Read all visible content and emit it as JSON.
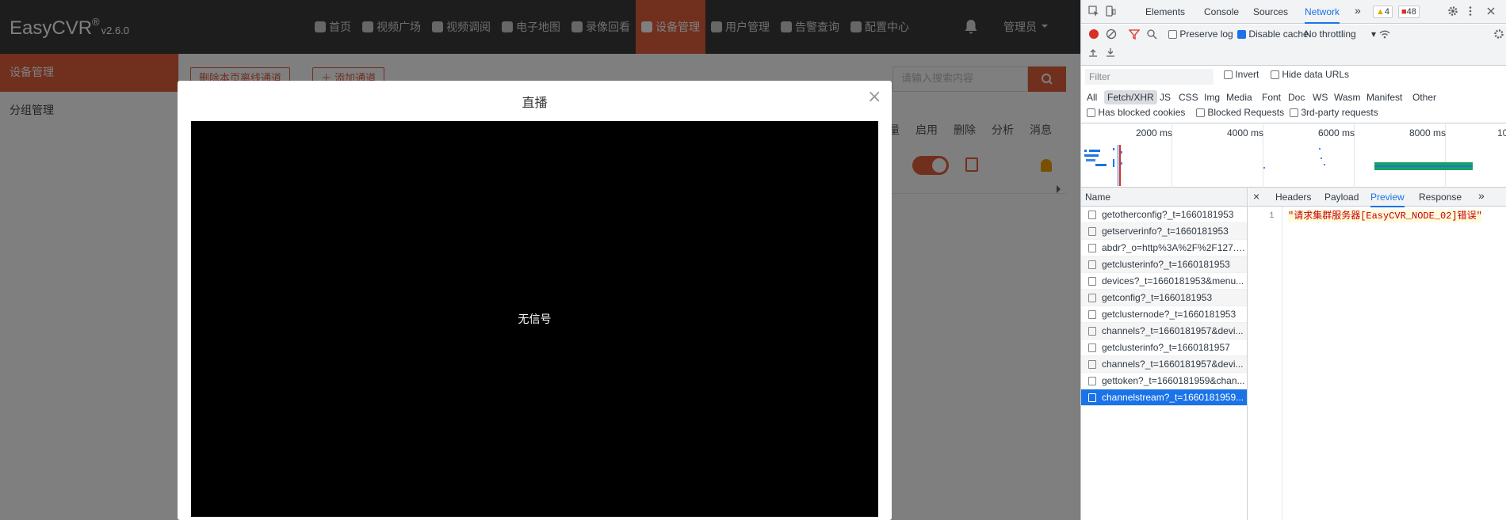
{
  "app": {
    "brand": "EasyCVR",
    "brand_mark": "®",
    "version": "v2.6.0",
    "nav": [
      {
        "label": "首页",
        "icon": "dashboard-icon"
      },
      {
        "label": "视频广场",
        "icon": "play-circle-icon"
      },
      {
        "label": "视频调阅",
        "icon": "grid-icon"
      },
      {
        "label": "电子地图",
        "icon": "map-pin-icon"
      },
      {
        "label": "录像回看",
        "icon": "video-camera-icon"
      },
      {
        "label": "设备管理",
        "icon": "device-icon",
        "active": true
      },
      {
        "label": "用户管理",
        "icon": "user-icon"
      },
      {
        "label": "告警查询",
        "icon": "alarm-icon"
      },
      {
        "label": "配置中心",
        "icon": "gear-icon"
      }
    ],
    "user": "管理员",
    "accent": "#e25e3d",
    "sidebar": [
      {
        "label": "设备管理",
        "active": true
      },
      {
        "label": "分组管理"
      }
    ],
    "toolbar": {
      "delete_offline": "删除本页离线通道",
      "add_channel": "添加通道",
      "search_placeholder": "请输入搜索内容"
    },
    "columns": [
      "量",
      "启用",
      "删除",
      "分析",
      "消息"
    ]
  },
  "dialog": {
    "title": "直播",
    "close": "×",
    "no_signal": "无信号"
  },
  "devtools": {
    "tabs": [
      "Elements",
      "Console",
      "Sources",
      "Network"
    ],
    "active_tab": "Network",
    "more": "»",
    "warnings": "4",
    "errors": "48",
    "preserve_log": "Preserve log",
    "disable_cache": "Disable cache",
    "throttling": "No throttling",
    "filter_placeholder": "Filter",
    "invert": "Invert",
    "hide_data_urls": "Hide data URLs",
    "types": [
      "All",
      "Fetch/XHR",
      "JS",
      "CSS",
      "Img",
      "Media",
      "Font",
      "Doc",
      "WS",
      "Wasm",
      "Manifest",
      "Other"
    ],
    "active_type": "Fetch/XHR",
    "blocked_cookies": "Has blocked cookies",
    "blocked_requests": "Blocked Requests",
    "third_party": "3rd-party requests",
    "timeline_labels": [
      "2000 ms",
      "4000 ms",
      "6000 ms",
      "8000 ms",
      "10"
    ],
    "name_header": "Name",
    "requests": [
      "getotherconfig?_t=1660181953",
      "getserverinfo?_t=1660181953",
      "abdr?_o=http%3A%2F%2F127.0...",
      "getclusterinfo?_t=1660181953",
      "devices?_t=1660181953&menu...",
      "getconfig?_t=1660181953",
      "getclusternode?_t=1660181953",
      "channels?_t=1660181957&devi...",
      "getclusterinfo?_t=1660181957",
      "channels?_t=1660181957&devi...",
      "gettoken?_t=1660181959&chan...",
      "channelstream?_t=1660181959..."
    ],
    "selected_request": 11,
    "detail_tabs": [
      "Headers",
      "Payload",
      "Preview",
      "Response"
    ],
    "active_detail_tab": "Preview",
    "detail_more": "»",
    "close_detail": "×",
    "line_number": "1",
    "response_text": "\"请求集群服务器[EasyCVR_NODE_02]错误\""
  }
}
